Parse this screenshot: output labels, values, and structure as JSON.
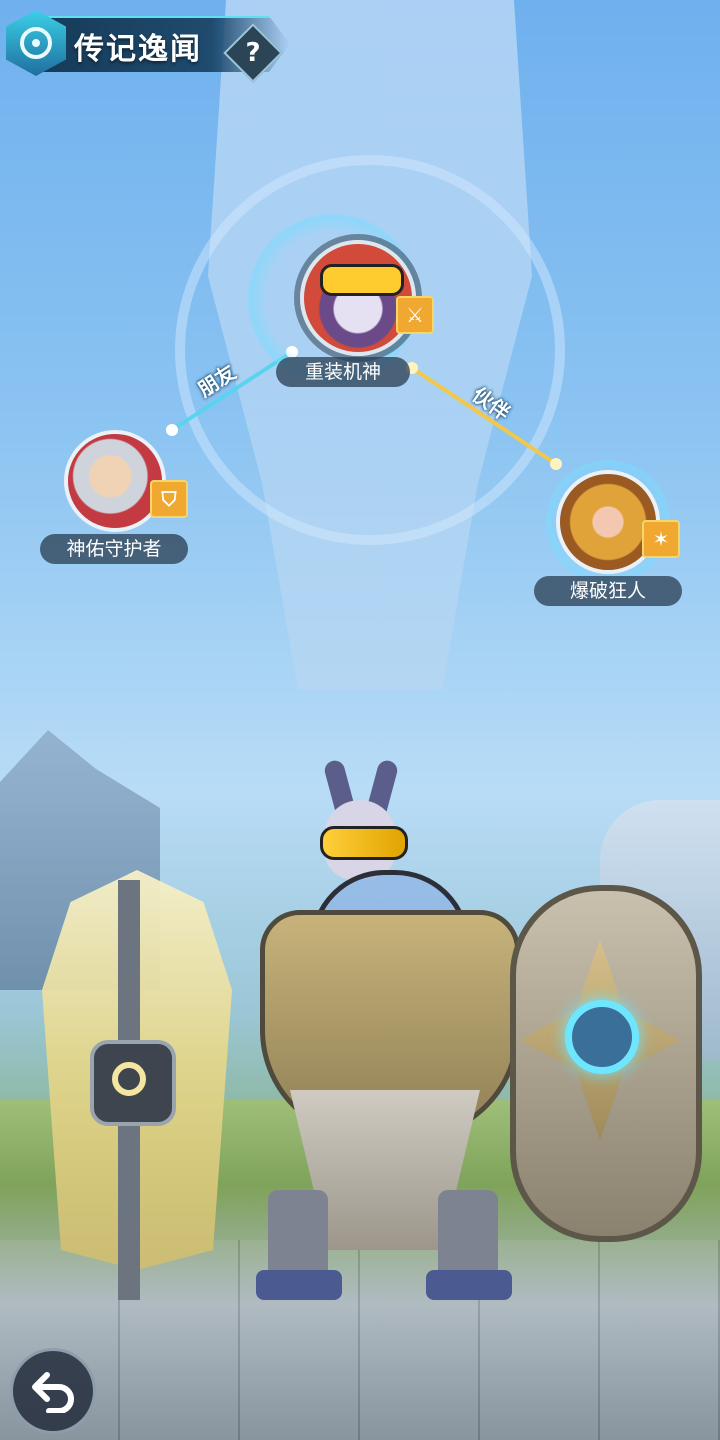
{
  "header": {
    "title": "传记逸闻",
    "help_label": "?"
  },
  "relations": [
    {
      "label": "朋友",
      "color": "#59d4ee"
    },
    {
      "label": "伙伴",
      "color": "#f2c84b"
    }
  ],
  "heroes": {
    "center": {
      "name": "重装机神",
      "badge_icon": "sword-class-icon",
      "badge_color": "#f0a830"
    },
    "left": {
      "name": "神佑守护者",
      "badge_icon": "shield-class-icon",
      "badge_color": "#f0a830"
    },
    "right": {
      "name": "爆破狂人",
      "badge_icon": "gun-class-icon",
      "badge_color": "#f0a830"
    }
  },
  "controls": {
    "back_icon": "back-arrow-icon"
  },
  "colors": {
    "accent": "#5fe0f0",
    "banner": "#1f4b6e"
  }
}
